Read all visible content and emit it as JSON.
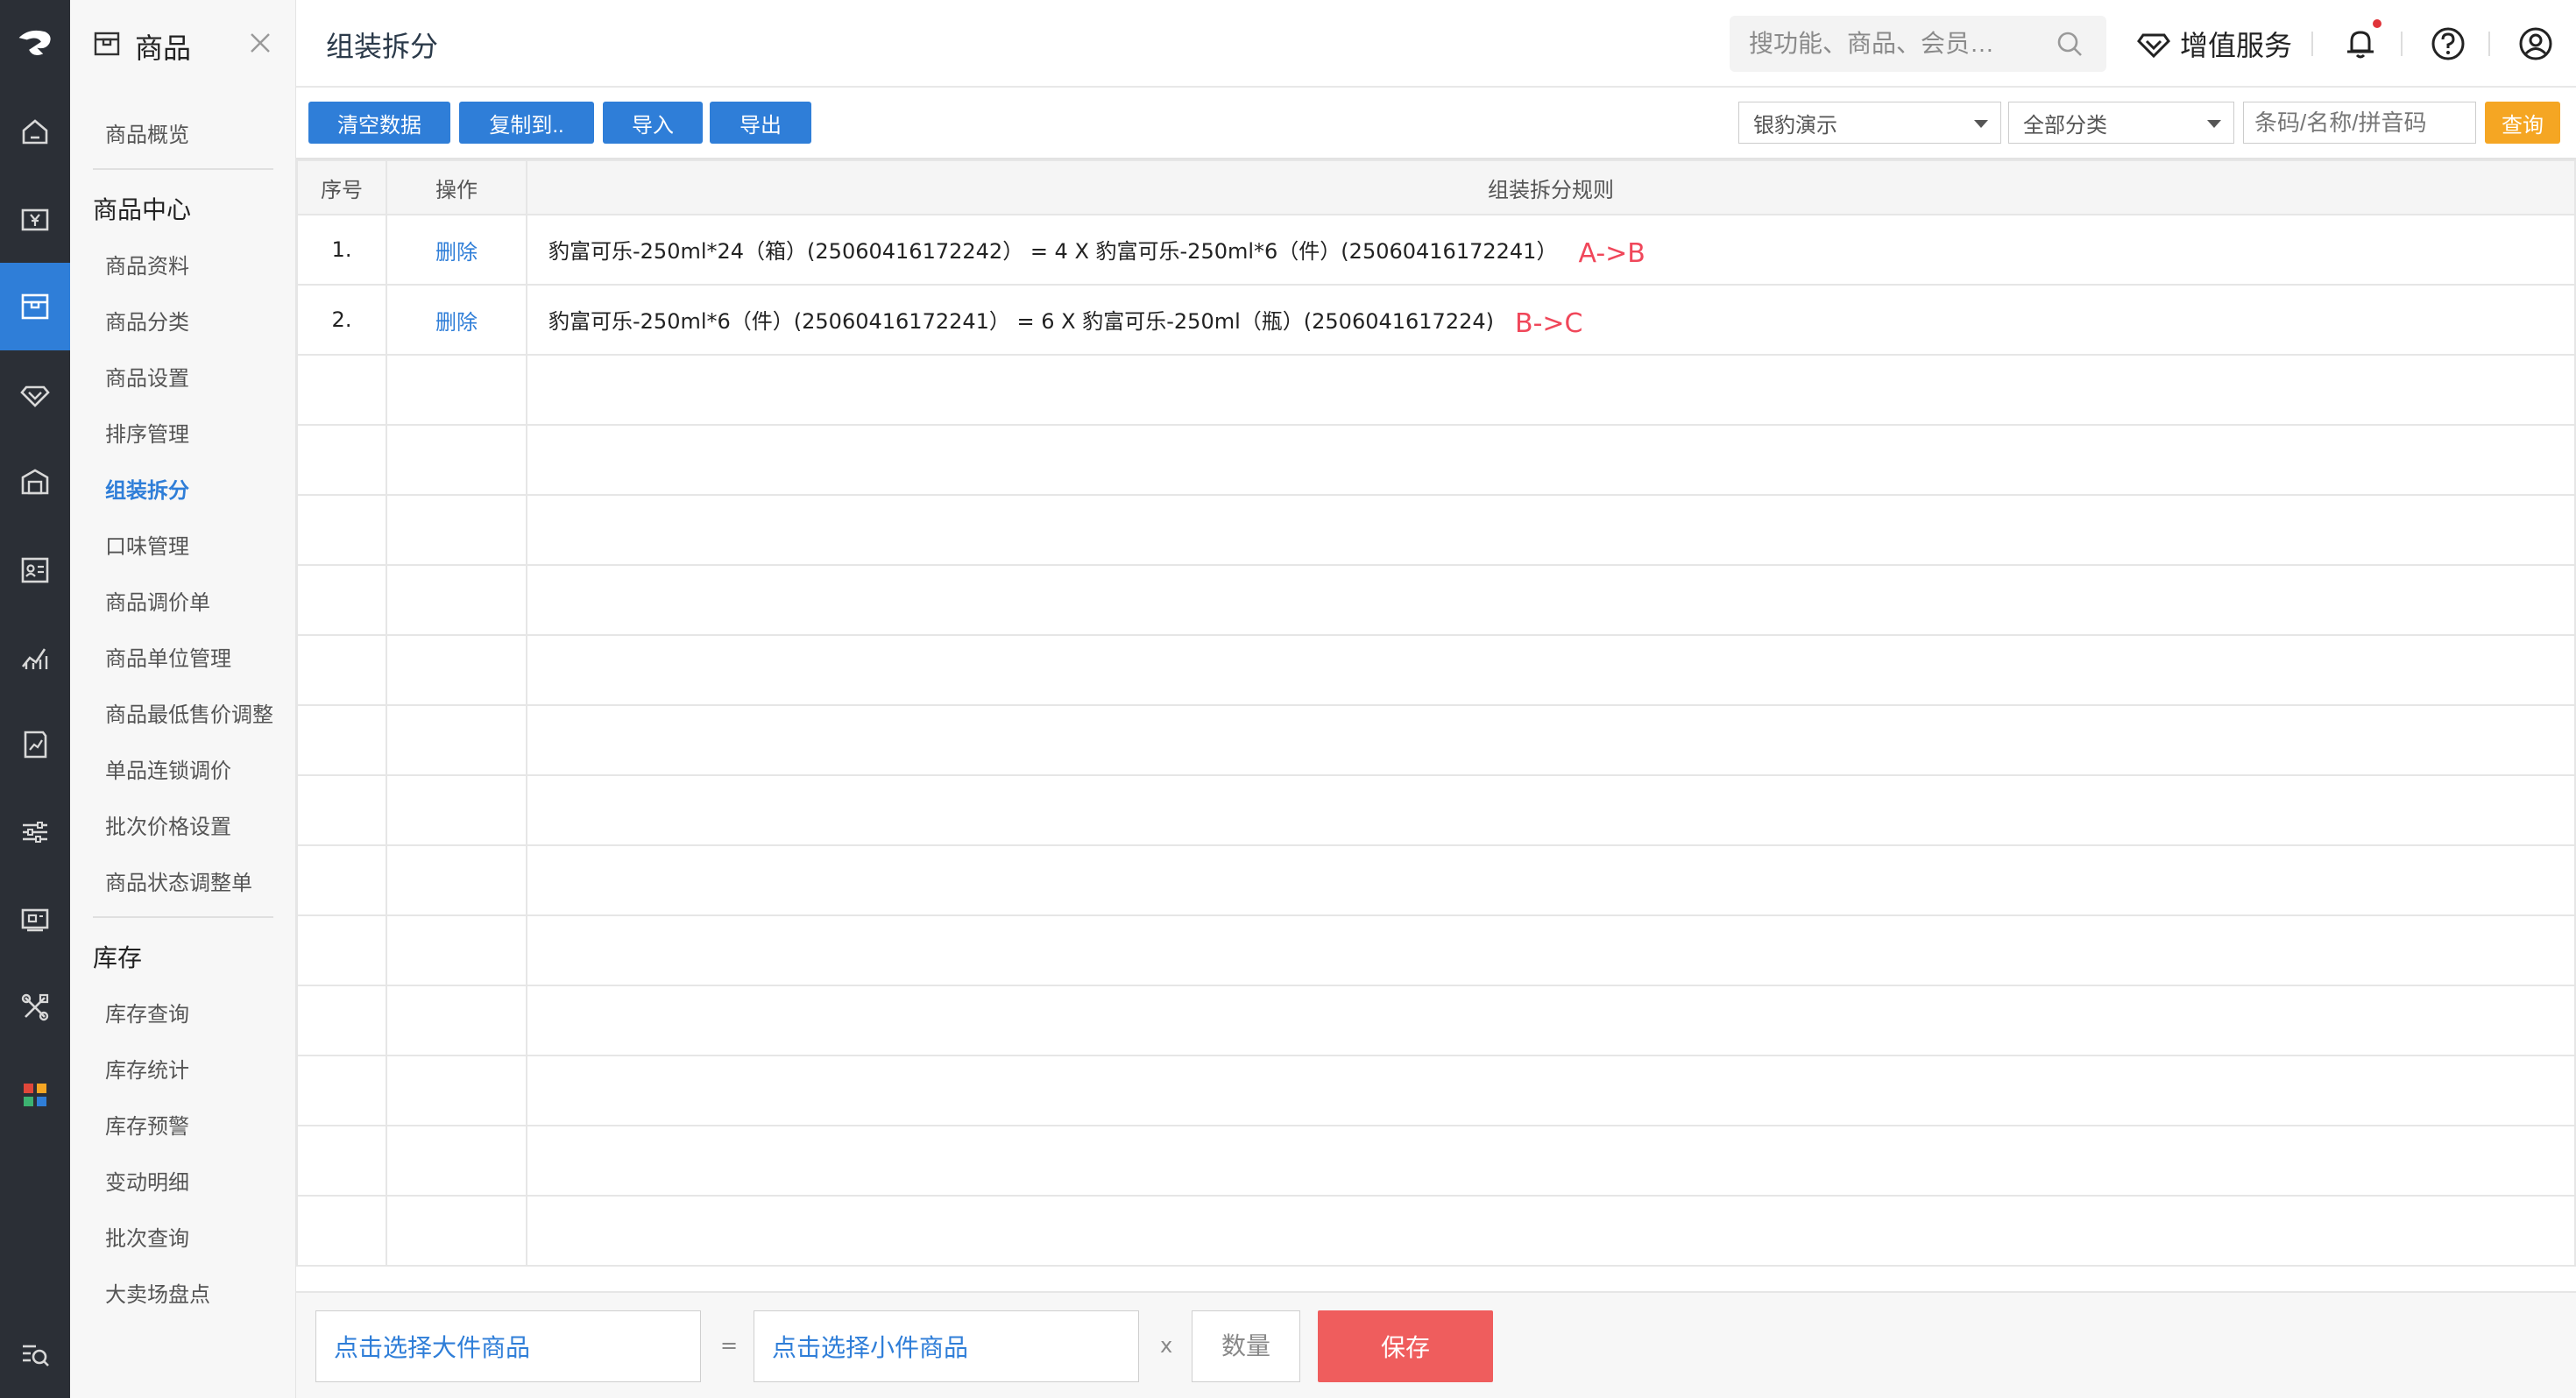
{
  "rail": {
    "logo": "logo-icon",
    "items": [
      {
        "icon": "home-icon"
      },
      {
        "icon": "cashier-icon"
      },
      {
        "icon": "product-icon",
        "active": true
      },
      {
        "icon": "member-icon"
      },
      {
        "icon": "stock-icon"
      },
      {
        "icon": "staff-icon"
      },
      {
        "icon": "report-icon"
      },
      {
        "icon": "finance-icon"
      },
      {
        "icon": "settings-sliders-icon"
      },
      {
        "icon": "device-icon"
      },
      {
        "icon": "tools-icon"
      },
      {
        "icon": "apps-icon"
      },
      {
        "icon": "search-list-icon"
      }
    ]
  },
  "menu": {
    "title": "商品",
    "overview": "商品概览",
    "section1": "商品中心",
    "items1": [
      "商品资料",
      "商品分类",
      "商品设置",
      "排序管理",
      "组装拆分",
      "口味管理",
      "商品调价单",
      "商品单位管理",
      "商品最低售价调整",
      "单品连锁调价",
      "批次价格设置",
      "商品状态调整单"
    ],
    "active": "组装拆分",
    "section2": "库存",
    "items2": [
      "库存查询",
      "库存统计",
      "库存预警",
      "变动明细",
      "批次查询",
      "大卖场盘点"
    ]
  },
  "topbar": {
    "page_title": "组装拆分",
    "search_placeholder": "搜功能、商品、会员…",
    "vas_label": "增值服务"
  },
  "toolbar": {
    "clear": "清空数据",
    "copy": "复制到..",
    "import": "导入",
    "export": "导出",
    "store_select": "银豹演示",
    "category_select": "全部分类",
    "filter_placeholder": "条码/名称/拼音码",
    "query": "查询"
  },
  "table": {
    "headers": [
      "序号",
      "操作",
      "组装拆分规则"
    ],
    "rows": [
      {
        "idx": "1.",
        "op": "删除",
        "rule": "豹富可乐-250ml*24（箱）(25060416172242） = 4 X 豹富可乐-250ml*6（件）(25060416172241）",
        "note": "A->B"
      },
      {
        "idx": "2.",
        "op": "删除",
        "rule": "豹富可乐-250ml*6（件）(25060416172241） = 6 X 豹富可乐-250ml（瓶）(2506041617224)",
        "note": "B->C"
      }
    ],
    "empty_rows": 13
  },
  "bottom": {
    "big_placeholder": "点击选择大件商品",
    "equals": "=",
    "small_placeholder": "点击选择小件商品",
    "times": "x",
    "qty_placeholder": "数量",
    "save": "保存"
  }
}
